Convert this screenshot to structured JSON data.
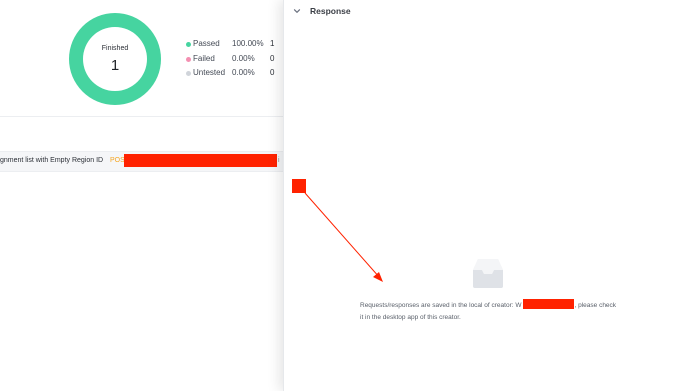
{
  "summary": {
    "donut_label": "Finished",
    "donut_value": "1",
    "legend": [
      {
        "name": "Passed",
        "pct": "100.00%",
        "count": "1",
        "color": "#46d4a0"
      },
      {
        "name": "Failed",
        "pct": "0.00%",
        "count": "0",
        "color": "#f48fb1"
      },
      {
        "name": "Untested",
        "pct": "0.00%",
        "count": "0",
        "color": "#d0d4da"
      }
    ]
  },
  "request_row": {
    "name": "gnment list with Empty Region ID",
    "method": "POST",
    "tail": "i"
  },
  "response": {
    "title": "Response",
    "empty_line1_prefix": "Requests/responses are saved in the local of creator: W",
    "empty_line1_suffix": ", please check",
    "empty_line2": "it in the desktop app of this creator."
  },
  "icons": {
    "collapse": "chevron-down-icon",
    "empty": "inbox-icon"
  },
  "colors": {
    "accent_green": "#46d4a0",
    "method_orange": "#f5a623",
    "redaction_red": "#ff2200"
  }
}
